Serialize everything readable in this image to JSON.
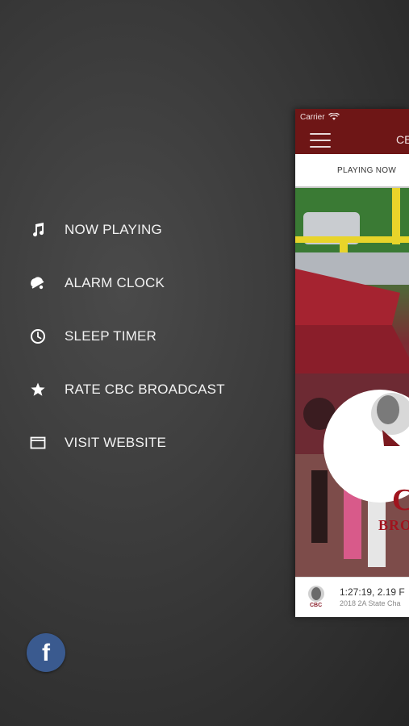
{
  "menu": {
    "items": [
      {
        "label": "NOW PLAYING",
        "icon": "music-note-icon"
      },
      {
        "label": "ALARM CLOCK",
        "icon": "bell-icon"
      },
      {
        "label": "SLEEP TIMER",
        "icon": "clock-icon"
      },
      {
        "label": "RATE CBC BROADCAST",
        "icon": "star-icon"
      },
      {
        "label": "VISIT WEBSITE",
        "icon": "browser-window-icon"
      }
    ]
  },
  "social": {
    "facebook_glyph": "f"
  },
  "preview": {
    "status_carrier": "Carrier",
    "app_title": "CE",
    "tab_label": "PLAYING NOW",
    "hero_text_1": "C",
    "hero_text_2": "BRO",
    "footer_time": "1:27:19, 2.19 F",
    "footer_subtitle": "2018 2A State Cha",
    "logo_text": "CBC"
  },
  "colors": {
    "app_bar": "#6e1616",
    "facebook": "#3a5a8f",
    "background": "#3a3a3a"
  }
}
